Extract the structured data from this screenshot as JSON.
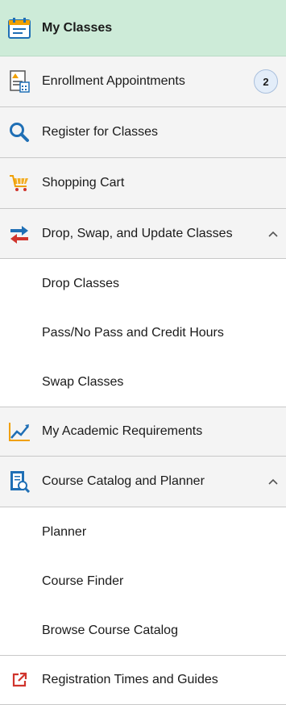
{
  "nav": {
    "my_classes": "My Classes",
    "enrollment_appointments": "Enrollment Appointments",
    "enrollment_badge": "2",
    "register": "Register for Classes",
    "shopping_cart": "Shopping Cart",
    "drop_swap_update": "Drop, Swap, and Update Classes",
    "drop_sub": [
      "Drop Classes",
      "Pass/No Pass and Credit Hours",
      "Swap Classes"
    ],
    "academic_requirements": "My Academic Requirements",
    "catalog_planner": "Course Catalog and Planner",
    "catalog_sub": [
      "Planner",
      "Course Finder",
      "Browse Course Catalog"
    ],
    "registration_times": "Registration Times and Guides"
  },
  "colors": {
    "active_bg": "#cdebd8",
    "item_bg": "#f4f4f4",
    "accent_blue": "#1f6fb5",
    "accent_orange": "#f0a000",
    "accent_red": "#d0342c"
  }
}
